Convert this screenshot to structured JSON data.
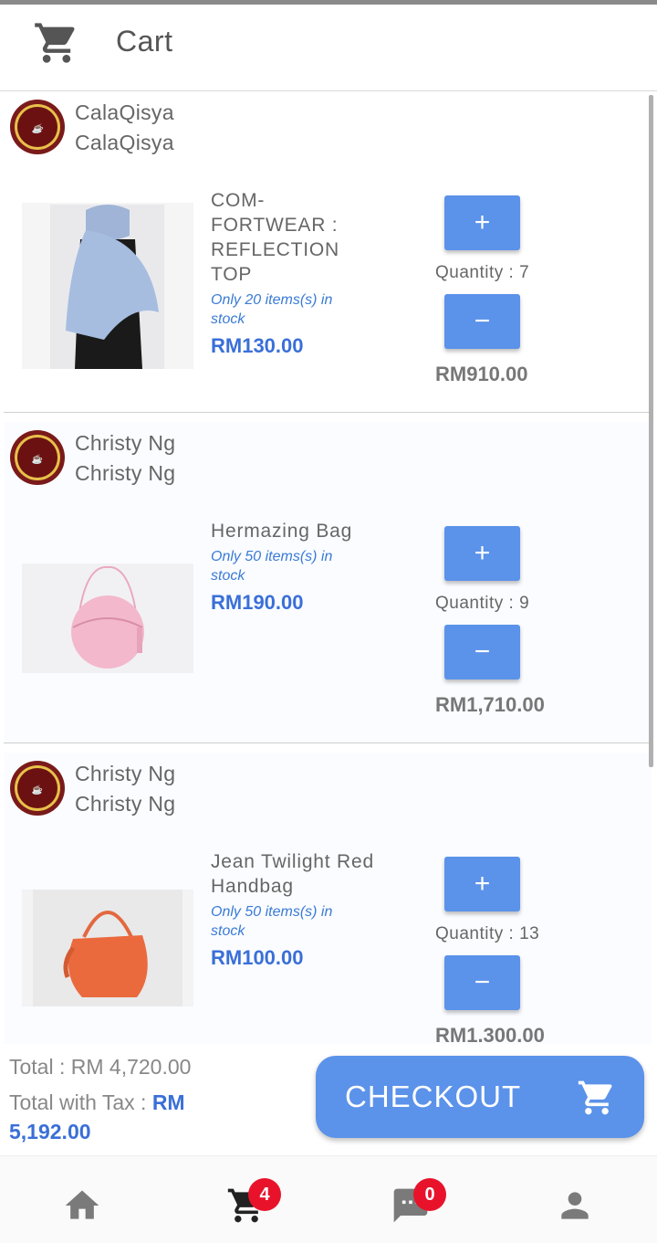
{
  "header": {
    "title": "Cart",
    "icon": "cart-icon"
  },
  "items": [
    {
      "seller_name": "CalaQisya",
      "seller_sub": "CalaQisya",
      "product_name": "COM-FORTWEAR : REFLECTION TOP",
      "stock": "Only 20 items(s) in stock",
      "price": "RM130.00",
      "quantity": "Quantity : 7",
      "subtotal": "RM910.00",
      "plus": "+",
      "minus": "−"
    },
    {
      "seller_name": "Christy Ng",
      "seller_sub": "Christy Ng",
      "product_name": "Hermazing Bag",
      "stock": "Only 50 items(s) in stock",
      "price": "RM190.00",
      "quantity": "Quantity : 9",
      "subtotal": "RM1,710.00",
      "plus": "+",
      "minus": "−"
    },
    {
      "seller_name": "Christy Ng",
      "seller_sub": "Christy Ng",
      "product_name": "Jean Twilight Red Handbag",
      "stock": "Only 50 items(s) in stock",
      "price": "RM100.00",
      "quantity": "Quantity : 13",
      "subtotal": "RM1.300.00",
      "plus": "+",
      "minus": "−"
    }
  ],
  "footer": {
    "total": "Total : RM 4,720.00",
    "tax_label": "Total with Tax : ",
    "tax_value": "RM 5,192.00",
    "checkout_label": "CHECKOUT"
  },
  "nav": {
    "cart_badge": "4",
    "chat_badge": "0"
  },
  "colors": {
    "accent": "#5b92ea",
    "price": "#3a6fd8",
    "badge": "#e8132b"
  }
}
